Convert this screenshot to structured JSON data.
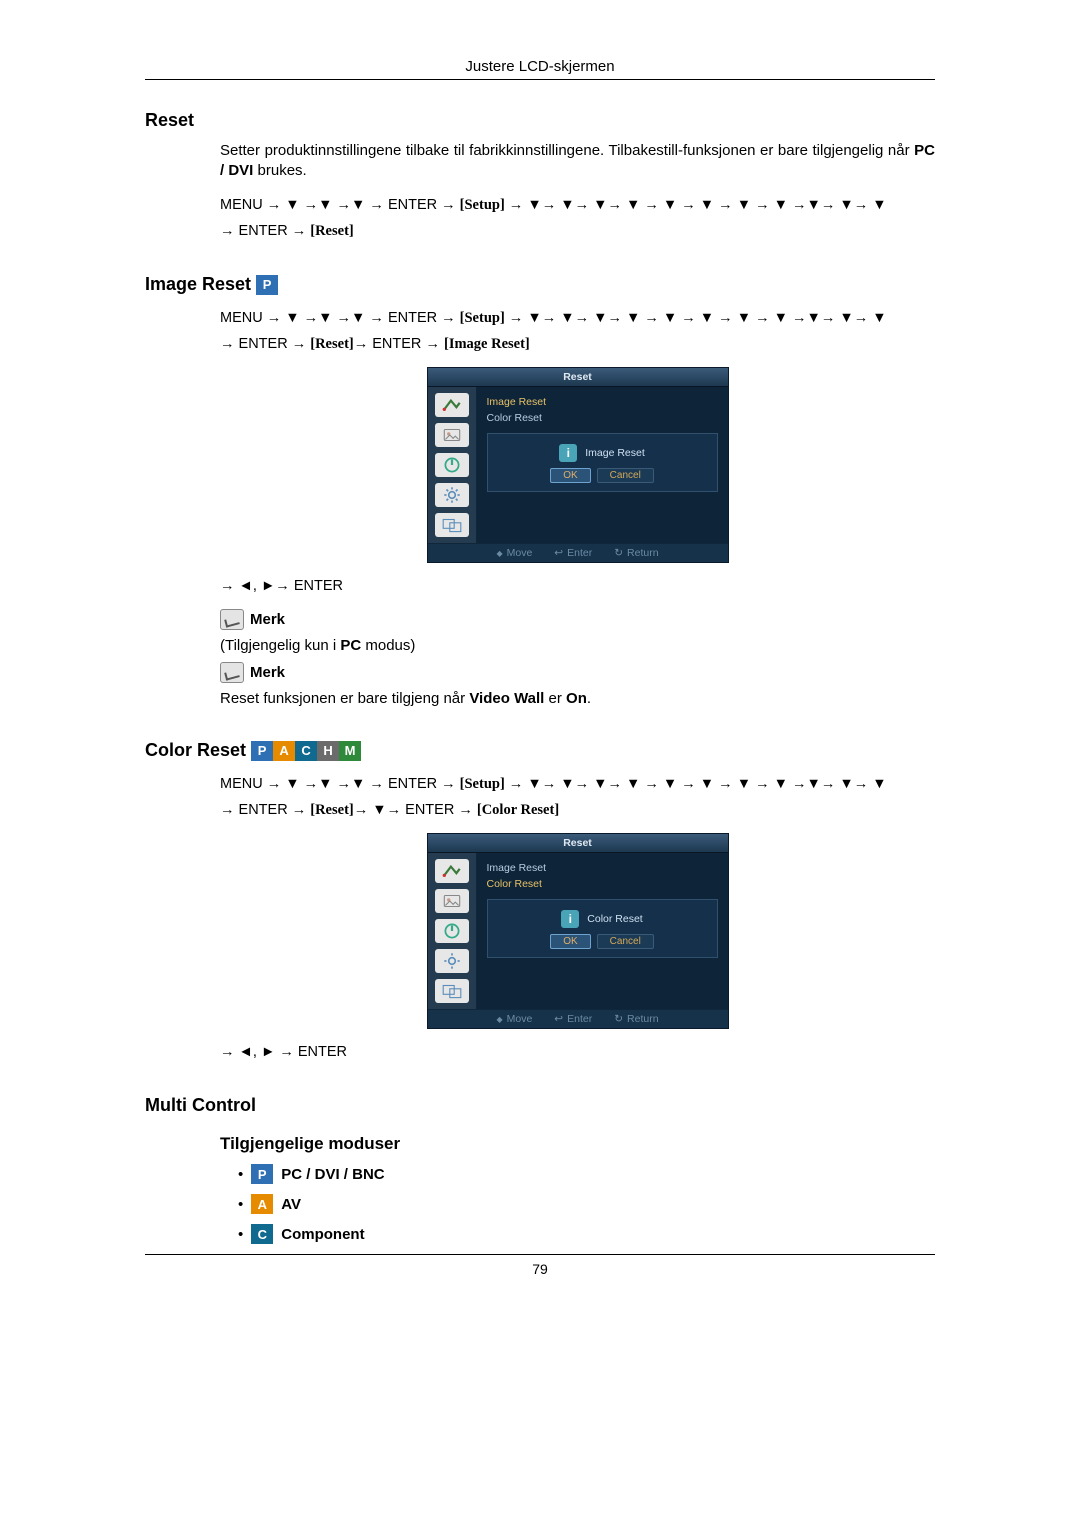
{
  "header": {
    "title": "Justere LCD-skjermen"
  },
  "footer": {
    "page": "79"
  },
  "sections": {
    "reset": {
      "title": "Reset",
      "desc_pre": "Setter produktinnstillingene tilbake til fabrikkinnstillingene. Tilbakestill-funksjonen er bare tilgjengelig når ",
      "desc_bold": "PC / DVI",
      "desc_post": " brukes.",
      "seq_menu": "MENU",
      "seq_enter": "ENTER",
      "seq_setup": "[Setup]",
      "seq_reset": "[Reset]"
    },
    "image_reset": {
      "title": "Image Reset",
      "seq_img": "[Image Reset]",
      "line_lr": ", ",
      "merk": "Merk",
      "note1_pre": "(Tilgjengelig kun i ",
      "note1_bold": "PC",
      "note1_post": " modus)",
      "note2_pre": "Reset funksjonen er bare tilgjeng når ",
      "note2_bold1": "Video Wall",
      "note2_mid": " er ",
      "note2_bold2": "On",
      "note2_post": "."
    },
    "color_reset": {
      "title": "Color Reset",
      "seq_color": "[Color Reset]"
    },
    "multi": {
      "title": "Multi Control",
      "sub": "Tilgjengelige moduser",
      "items": [
        {
          "badge": "P",
          "label": "PC / DVI / BNC"
        },
        {
          "badge": "A",
          "label": "AV"
        },
        {
          "badge": "C",
          "label": "Component"
        }
      ]
    }
  },
  "osd": {
    "title": "Reset",
    "list": {
      "image": "Image Reset",
      "color": "Color Reset"
    },
    "card1": "Image Reset",
    "card2": "Color Reset",
    "ok": "OK",
    "cancel": "Cancel",
    "hint_move": "Move",
    "hint_enter": "Enter",
    "hint_return": "Return"
  }
}
